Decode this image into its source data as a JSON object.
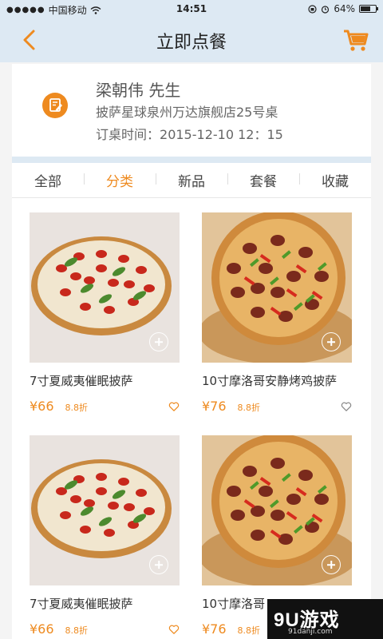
{
  "status_bar": {
    "carrier": "中国移动",
    "time": "14:51",
    "battery": "64%",
    "battery_level": 0.64
  },
  "nav": {
    "title": "立即点餐"
  },
  "order": {
    "customer": "梁朝伟 先生",
    "store_table": "披萨星球泉州万达旗舰店25号桌",
    "time_label": "订桌时间：",
    "time_value": "2015-12-10 12：15"
  },
  "tabs": [
    {
      "label": "全部"
    },
    {
      "label": "分类"
    },
    {
      "label": "新品"
    },
    {
      "label": "套餐"
    },
    {
      "label": "收藏"
    }
  ],
  "active_tab": 1,
  "products": [
    {
      "name": "7寸夏威夷催眠披萨",
      "price": "¥66",
      "discount": "8.8折",
      "image": "margherita-pizza-image"
    },
    {
      "name": "10寸摩洛哥安静烤鸡披萨",
      "price": "¥76",
      "discount": "8.8折",
      "image": "chicken-pepper-pizza-image"
    },
    {
      "name": "7寸夏威夷催眠披萨",
      "price": "¥66",
      "discount": "8.8折",
      "image": "margherita-pizza-image"
    },
    {
      "name": "10寸摩洛哥",
      "price": "¥76",
      "discount": "8.8折",
      "image": "chicken-pepper-pizza-image"
    }
  ],
  "colors": {
    "accent": "#ee8a1f",
    "header_bg": "#dde9f3"
  },
  "watermark": {
    "logo": "9U游戏",
    "url": "91danji.com"
  }
}
